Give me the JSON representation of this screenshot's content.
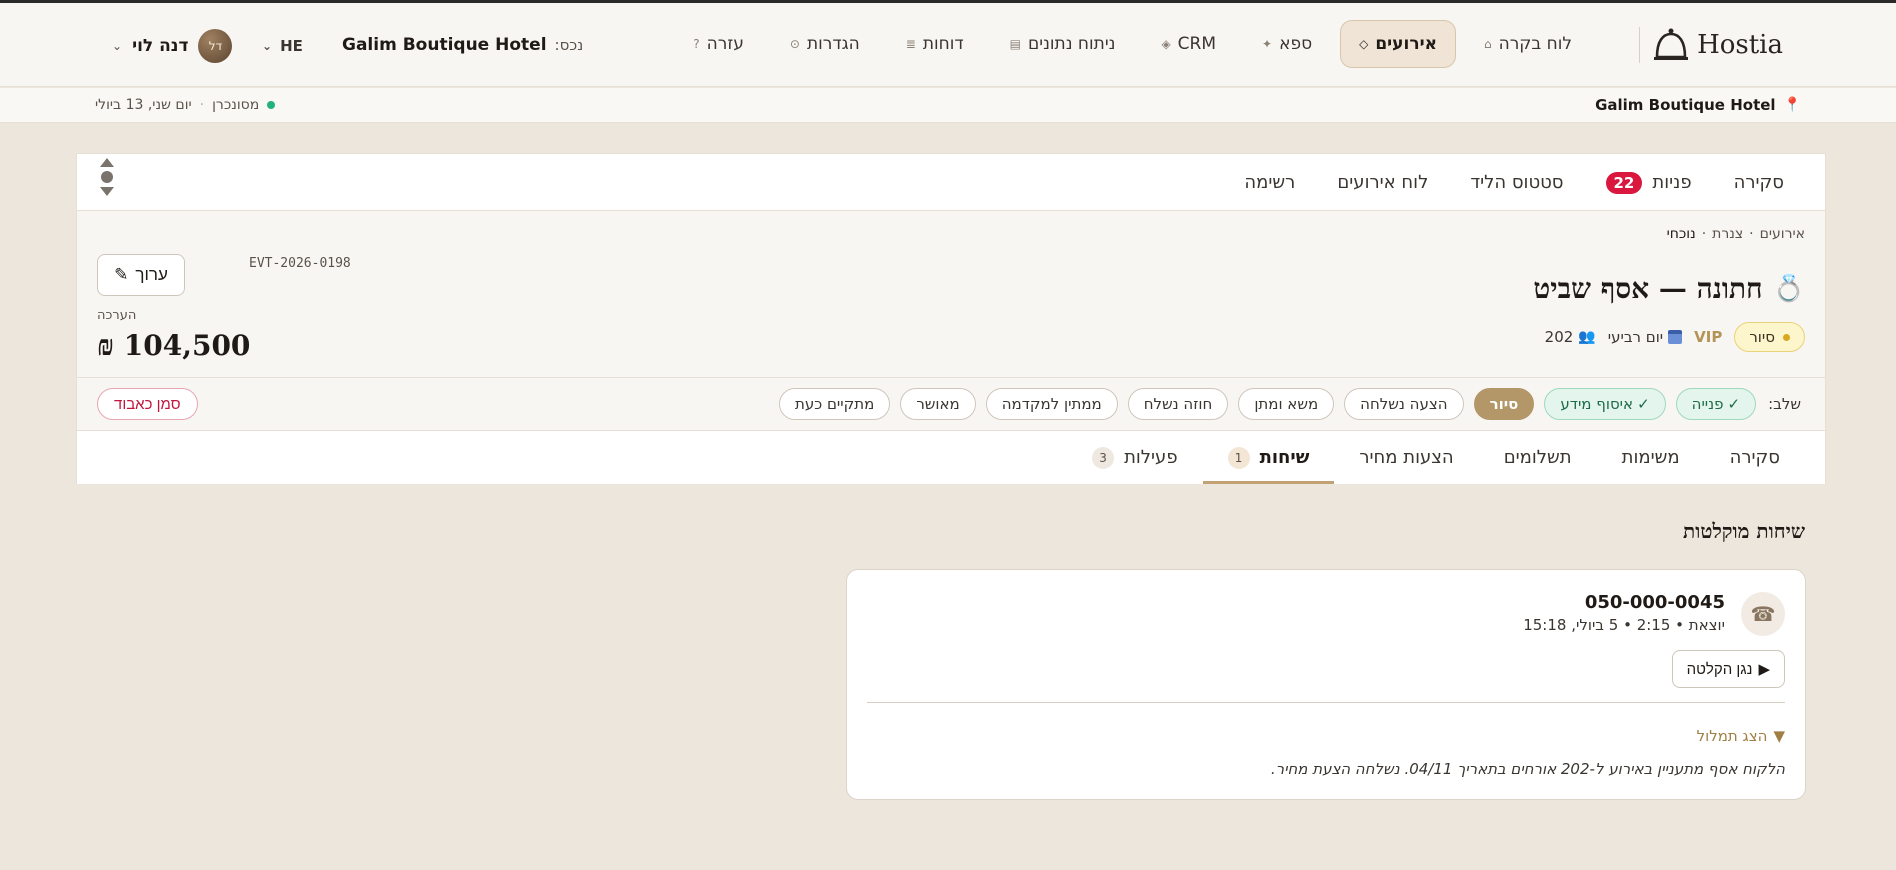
{
  "brand": {
    "name": "Hostia"
  },
  "nav": {
    "items": [
      {
        "label": "לוח בקרה",
        "icon": "⌂"
      },
      {
        "label": "אירועים",
        "icon": "◇",
        "active": true
      },
      {
        "label": "ספא",
        "icon": "✦"
      },
      {
        "label": "CRM",
        "icon": "◈"
      },
      {
        "label": "ניתוח נתונים",
        "icon": "▤"
      },
      {
        "label": "דוחות",
        "icon": "≣"
      },
      {
        "label": "הגדרות",
        "icon": "⊙"
      },
      {
        "label": "עזרה",
        "icon": "?"
      }
    ]
  },
  "property": {
    "label": "נכס:",
    "name": "Galim Boutique Hotel"
  },
  "lang": {
    "code": "HE"
  },
  "user": {
    "initials": "דל",
    "name": "דנה לוי"
  },
  "subbar": {
    "hotel": "Galim Boutique Hotel",
    "sync": "מסונכרן",
    "date": "יום שני, 13 ביולי"
  },
  "card_tabs": {
    "overview": "סקירה",
    "inquiries": "פניות",
    "inquiries_count": "22",
    "lead_status": "סטטוס הליד",
    "event_board": "לוח אירועים",
    "list": "רשימה"
  },
  "breadcrumb": {
    "root": "אירועים",
    "mid": "צנרת",
    "current": "נוכחי",
    "sep": "·"
  },
  "event": {
    "icon": "💍",
    "title": "חתונה — אסף שביט",
    "status": "סיור",
    "vip": "VIP",
    "day": "יום רביעי",
    "guests": "202",
    "id": "EVT-2026-0198",
    "edit_label": "ערוך",
    "value_label": "הערכה",
    "value": "₪ 104,500"
  },
  "stages": {
    "label": "שלב:",
    "items": [
      {
        "label": "פנייה",
        "state": "done"
      },
      {
        "label": "איסוף מידע",
        "state": "done"
      },
      {
        "label": "סיור",
        "state": "current"
      },
      {
        "label": "הצעה נשלחה",
        "state": "todo"
      },
      {
        "label": "משא ומתן",
        "state": "todo"
      },
      {
        "label": "חוזה נשלח",
        "state": "todo"
      },
      {
        "label": "ממתין למקדמה",
        "state": "todo"
      },
      {
        "label": "מאושר",
        "state": "todo"
      },
      {
        "label": "מתקיים כעת",
        "state": "todo"
      }
    ],
    "mark_lost": "סמן כאבוד"
  },
  "detail_tabs": {
    "overview": "סקירה",
    "tasks": "משימות",
    "payments": "תשלומים",
    "quotes": "הצעות מחיר",
    "calls": "שיחות",
    "calls_count": "1",
    "activity": "פעילות",
    "activity_count": "3"
  },
  "calls_section": {
    "title": "שיחות מוקלטות",
    "call": {
      "number": "050-000-0045",
      "meta": "יוצאת • 2:15 • 5 ביולי, 15:18",
      "play": "נגן הקלטה",
      "transcript_toggle": "הצג תמלול",
      "summary": "הלקוח אסף מתעניין באירוע ל-202 אורחים בתאריך 04/11. נשלחה הצעת מחיר."
    }
  }
}
